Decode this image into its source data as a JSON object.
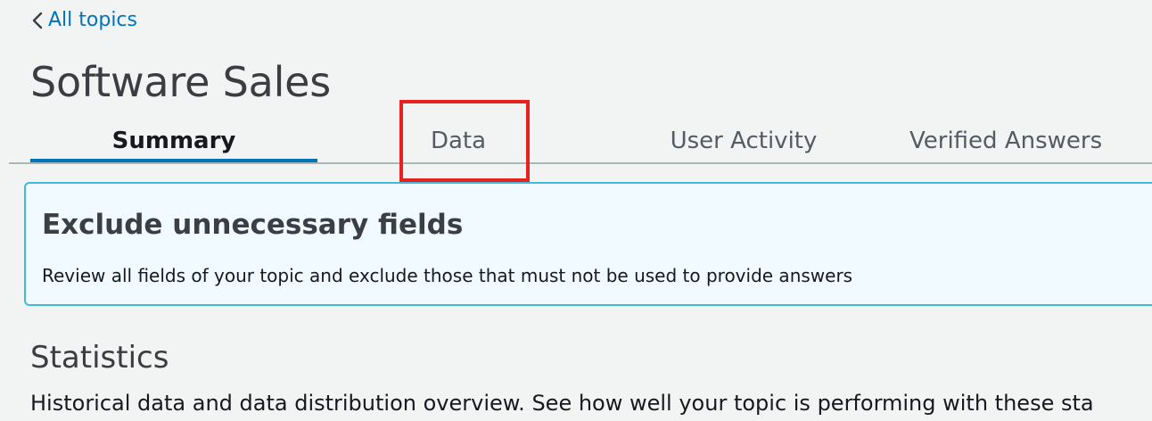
{
  "nav": {
    "back_label": "All topics"
  },
  "page": {
    "title": "Software Sales"
  },
  "tabs": [
    {
      "label": "Summary",
      "active": true
    },
    {
      "label": "Data",
      "active": false
    },
    {
      "label": "User Activity",
      "active": false
    },
    {
      "label": "Verified Answers",
      "active": false
    }
  ],
  "banner": {
    "title": "Exclude unnecessary fields",
    "description": "Review all fields of your topic and exclude those that must not be used to provide answers"
  },
  "statistics": {
    "heading": "Statistics",
    "description": "Historical data and data distribution overview. See how well your topic is performing with these sta"
  },
  "colors": {
    "accent": "#0073bb",
    "highlight": "#e8201e",
    "banner_border": "#44b9d6",
    "banner_background": "#f1faff"
  },
  "icons": {
    "back": "chevron-left-icon"
  }
}
